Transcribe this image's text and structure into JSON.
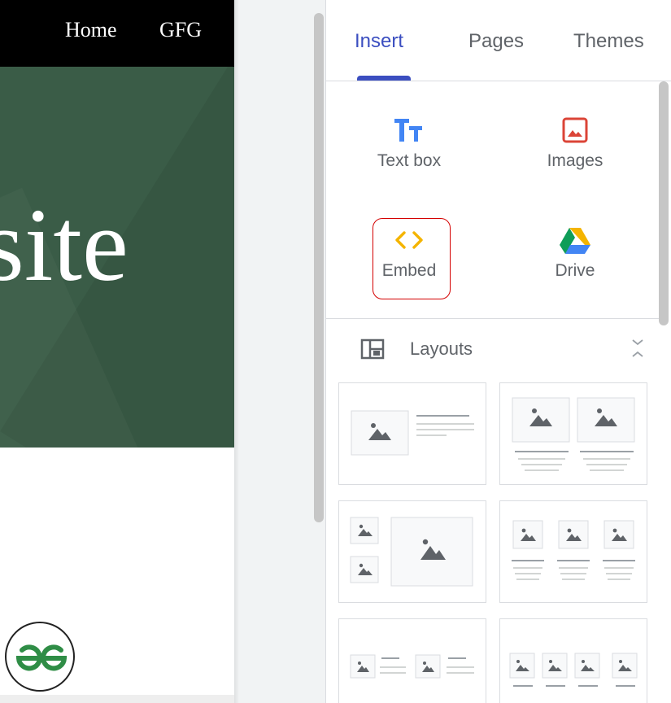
{
  "site": {
    "nav": {
      "home": "Home",
      "gfg": "GFG"
    },
    "hero_text": "site",
    "logo_alt": "GfG"
  },
  "panel": {
    "tabs": [
      {
        "label": "Insert",
        "active": true
      },
      {
        "label": "Pages",
        "active": false
      },
      {
        "label": "Themes",
        "active": false
      }
    ],
    "items": {
      "text_box": "Text box",
      "images": "Images",
      "embed": "Embed",
      "drive": "Drive"
    },
    "layouts": {
      "label": "Layouts"
    }
  },
  "colors": {
    "accent": "#3b4ec0",
    "hero_bg": "#3a5c47",
    "nav_bg": "#000000",
    "embed_highlight": "#d40000",
    "logo_green": "#2f8d46"
  },
  "icons": {
    "text_box": "text-box-icon",
    "images": "image-icon",
    "embed": "code-brackets-icon",
    "drive": "google-drive-icon",
    "layouts": "layout-grid-icon",
    "collapse": "unfold-less-icon"
  }
}
